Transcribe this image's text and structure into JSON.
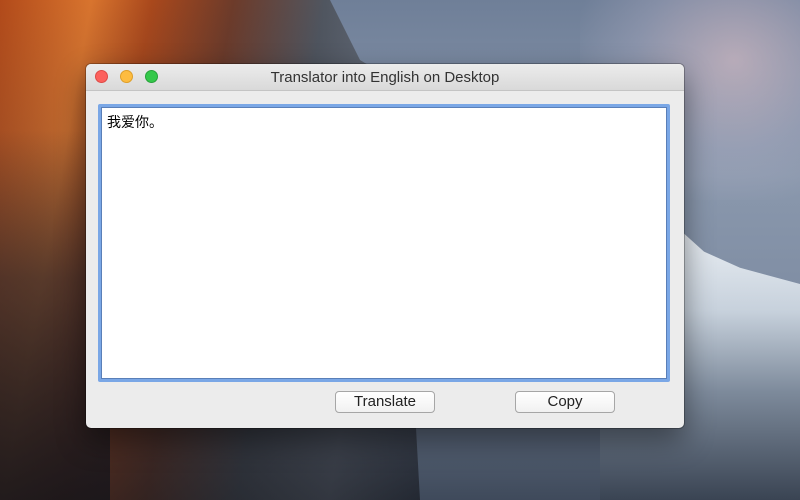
{
  "window": {
    "title": "Translator into English on Desktop"
  },
  "input": {
    "value": "我爱你。"
  },
  "buttons": {
    "translate_label": "Translate",
    "copy_label": "Copy"
  },
  "traffic_lights": {
    "close_color": "#fc615d",
    "minimize_color": "#fdbc40",
    "zoom_color": "#34c84a"
  },
  "accent": {
    "focus_ring": "#7aa7e6"
  },
  "icons": [
    "close-icon",
    "minimize-icon",
    "zoom-icon"
  ]
}
